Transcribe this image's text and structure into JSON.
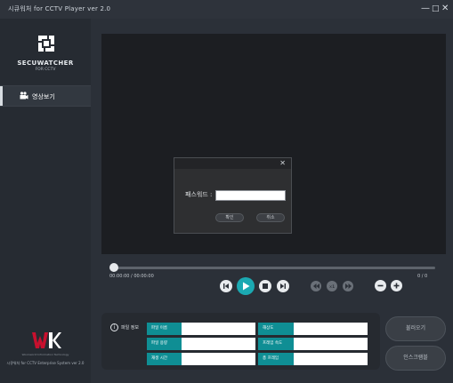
{
  "window": {
    "title": "시큐워처 for CCTV Player ver 2.0",
    "minimize_glyph": "—",
    "maximize_glyph": "□",
    "close_glyph": "✕"
  },
  "sidebar": {
    "brand": "SECUWATCHER",
    "brand_sub": "FOR CCTV",
    "menu": [
      {
        "label": "영상보기",
        "icon": "video-camera-icon"
      }
    ],
    "vendor_tagline": "Wooriworld Information Technology",
    "footer": "시큐워처 for CCTV Enterprise System ver 2.0"
  },
  "dialog": {
    "close_glyph": "✕",
    "password_label": "패스워드 :",
    "password_value": "",
    "confirm_label": "확인",
    "cancel_label": "취소"
  },
  "player": {
    "time": "00:00:00 / 00:00:00",
    "frame_counter": "0 / 0",
    "progress": 0
  },
  "file_info": {
    "title": "파일 정보",
    "rows": [
      {
        "left_label": "파일 이름",
        "left_value": "",
        "right_label": "해상도",
        "right_value": ""
      },
      {
        "left_label": "파일 용량",
        "left_value": "",
        "right_label": "프레임 속도",
        "right_value": ""
      },
      {
        "left_label": "재생 시간",
        "left_value": "",
        "right_label": "총 프레임",
        "right_value": ""
      }
    ]
  },
  "actions": {
    "load_label": "불러오기",
    "encode_label": "인스크램블"
  },
  "colors": {
    "accent": "#0f8e94",
    "play_button": "#1ba9b2",
    "logo_red": "#c8102e"
  }
}
